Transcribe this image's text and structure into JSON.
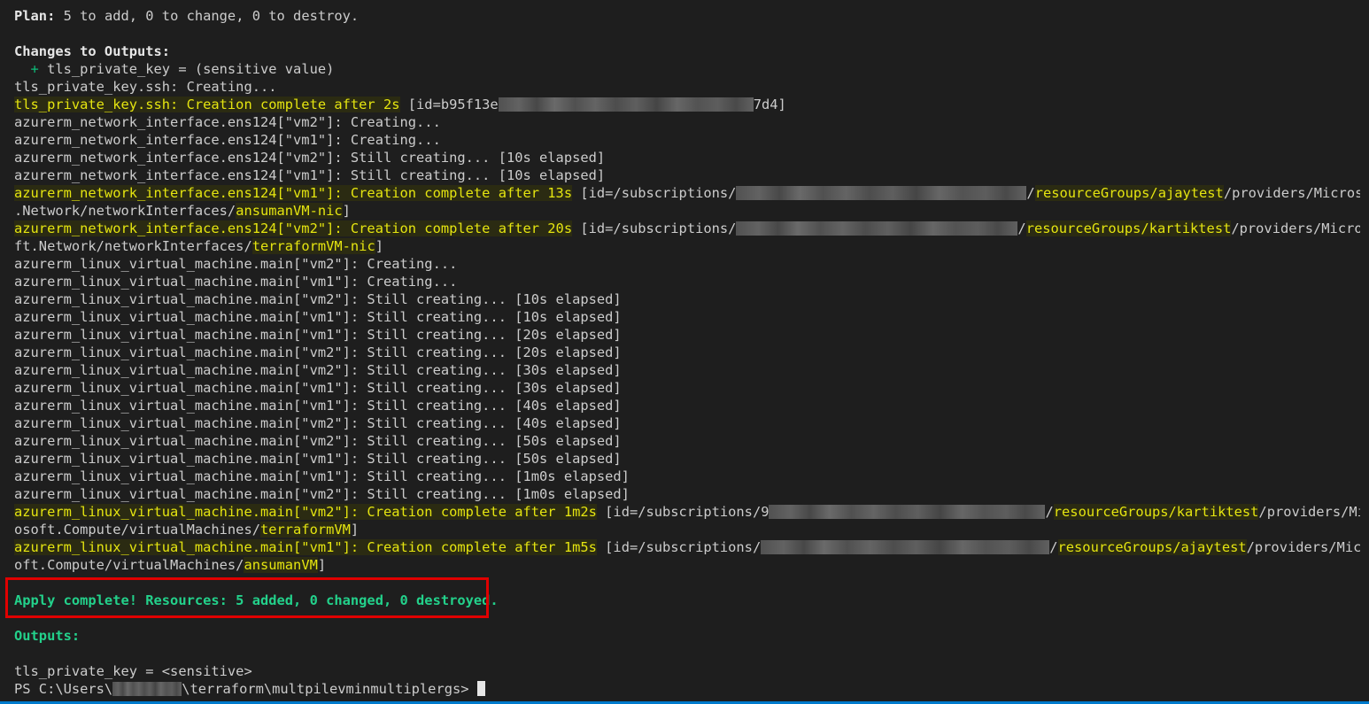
{
  "plan": {
    "label": "Plan:",
    "text": " 5 to add, 0 to change, 0 to destroy."
  },
  "changes_to_outputs": {
    "heading": "Changes to Outputs:",
    "plus": "  + ",
    "item": "tls_private_key = (sensitive value)"
  },
  "log": {
    "l1": "tls_private_key.ssh: Creating...",
    "l2_hl": "tls_private_key.ssh: Creation complete after 2s",
    "l2_a": " [id=b95f13e",
    "l2_b": "7d4]",
    "l3": "azurerm_network_interface.ens124[\"vm2\"]: Creating...",
    "l4": "azurerm_network_interface.ens124[\"vm1\"]: Creating...",
    "l5": "azurerm_network_interface.ens124[\"vm2\"]: Still creating... [10s elapsed]",
    "l6": "azurerm_network_interface.ens124[\"vm1\"]: Still creating... [10s elapsed]",
    "l7_hl": "azurerm_network_interface.ens124[\"vm1\"]: Creation complete after 13s",
    "l7_a": " [id=/subscriptions/",
    "l7_b": "/",
    "l7_c": "resourceGroups/ajaytest",
    "l7_d": "/providers/Microsoft",
    "l8_a": ".Network/networkInterfaces/",
    "l8_b": "ansumanVM-nic",
    "l8_c": "]",
    "l9_hl": "azurerm_network_interface.ens124[\"vm2\"]: Creation complete after 20s",
    "l9_a": " [id=/subscriptions/",
    "l9_b": "/",
    "l9_c": "resourceGroups/kartiktest",
    "l9_d": "/providers/Microso",
    "l10_a": "ft.Network/networkInterfaces/",
    "l10_b": "terraformVM-nic",
    "l10_c": "]",
    "l11": "azurerm_linux_virtual_machine.main[\"vm2\"]: Creating...",
    "l12": "azurerm_linux_virtual_machine.main[\"vm1\"]: Creating...",
    "l13": "azurerm_linux_virtual_machine.main[\"vm2\"]: Still creating... [10s elapsed]",
    "l14": "azurerm_linux_virtual_machine.main[\"vm1\"]: Still creating... [10s elapsed]",
    "l15": "azurerm_linux_virtual_machine.main[\"vm1\"]: Still creating... [20s elapsed]",
    "l16": "azurerm_linux_virtual_machine.main[\"vm2\"]: Still creating... [20s elapsed]",
    "l17": "azurerm_linux_virtual_machine.main[\"vm2\"]: Still creating... [30s elapsed]",
    "l18": "azurerm_linux_virtual_machine.main[\"vm1\"]: Still creating... [30s elapsed]",
    "l19": "azurerm_linux_virtual_machine.main[\"vm1\"]: Still creating... [40s elapsed]",
    "l20": "azurerm_linux_virtual_machine.main[\"vm2\"]: Still creating... [40s elapsed]",
    "l21": "azurerm_linux_virtual_machine.main[\"vm2\"]: Still creating... [50s elapsed]",
    "l22": "azurerm_linux_virtual_machine.main[\"vm1\"]: Still creating... [50s elapsed]",
    "l23": "azurerm_linux_virtual_machine.main[\"vm1\"]: Still creating... [1m0s elapsed]",
    "l24": "azurerm_linux_virtual_machine.main[\"vm2\"]: Still creating... [1m0s elapsed]",
    "l25_hl": "azurerm_linux_virtual_machine.main[\"vm2\"]: Creation complete after 1m2s",
    "l25_a": " [id=/subscriptions/9",
    "l25_b": "/",
    "l25_c": "resourceGroups/kartiktest",
    "l25_d": "/providers/Micr",
    "l26_a": "osoft.Compute/virtualMachines/",
    "l26_b": "terraformVM",
    "l26_c": "]",
    "l27_hl": "azurerm_linux_virtual_machine.main[\"vm1\"]: Creation complete after 1m5s",
    "l27_a": " [id=/subscriptions/",
    "l27_b": "/",
    "l27_c": "resourceGroups/ajaytest",
    "l27_d": "/providers/Micros",
    "l28_a": "oft.Compute/virtualMachines/",
    "l28_b": "ansumanVM",
    "l28_c": "]"
  },
  "apply": {
    "text": "Apply complete! Resources: 5 added, 0 changed, 0 destroyed."
  },
  "outputs": {
    "heading": "Outputs:",
    "tls": "tls_private_key = <sensitive>"
  },
  "prompt": {
    "prefix": "PS C:\\Users\\",
    "suffix": "\\terraform\\multpilevminmultiplergs> "
  },
  "colors": {
    "background": "#1e1e1e",
    "yellow_highlight": "#e5e510",
    "success_green": "#23d18b",
    "annotation_red": "#e00000"
  }
}
